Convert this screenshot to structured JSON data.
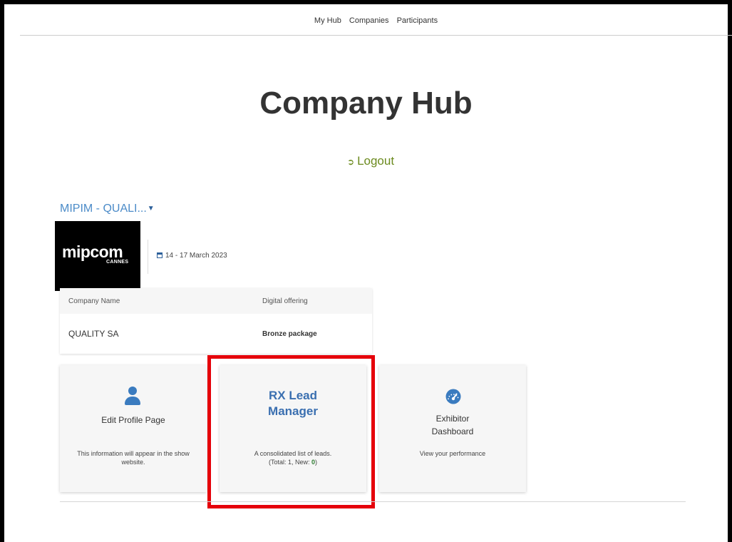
{
  "nav": {
    "items": [
      "My Hub",
      "Companies",
      "Participants"
    ]
  },
  "page": {
    "title": "Company Hub",
    "logout_label": "Logout"
  },
  "event": {
    "selector_label": "MIPIM - QUALI...",
    "logo_text": "mipcom",
    "logo_subtext": "CANNES",
    "date": "14 - 17 March 2023"
  },
  "company_table": {
    "headers": [
      "Company Name",
      "Digital offering"
    ],
    "row": [
      "QUALITY SA",
      "Bronze package"
    ]
  },
  "cards": {
    "edit_profile": {
      "title": "Edit Profile Page",
      "description": "This information will appear in the show website."
    },
    "lead_manager": {
      "title_line1": "RX Lead",
      "title_line2": "Manager",
      "description_line1": "A consolidated list of leads.",
      "description_prefix": "(Total: 1, New: ",
      "new_count": "0",
      "description_suffix": ")"
    },
    "dashboard": {
      "title_line1": "Exhibitor",
      "title_line2": "Dashboard",
      "description": "View your performance"
    }
  },
  "colors": {
    "accent_blue": "#3a7bbf",
    "logout_green": "#6b8a1e",
    "highlight_red": "#e5000a",
    "new_count_green": "#2e7d32"
  },
  "icons": {
    "logout": "sign-out-icon",
    "calendar": "calendar-icon",
    "profile": "person-icon",
    "dashboard": "speedometer-icon",
    "dropdown": "caret-down-icon"
  }
}
